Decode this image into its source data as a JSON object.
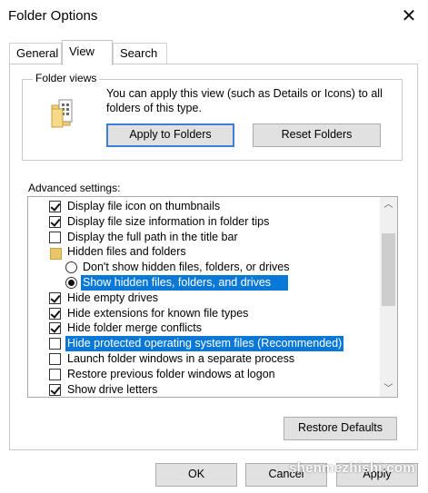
{
  "window": {
    "title": "Folder Options",
    "close_glyph": "✕"
  },
  "tabs": [
    {
      "label": "General"
    },
    {
      "label": "View"
    },
    {
      "label": "Search"
    }
  ],
  "folder_views": {
    "label": "Folder views",
    "icon": "folder-icon",
    "description": "You can apply this view (such as Details or Icons) to all folders of this type.",
    "apply_button": "Apply to Folders",
    "reset_button": "Reset Folders"
  },
  "advanced": {
    "label": "Advanced settings:",
    "items": [
      {
        "type": "checkbox",
        "checked": true,
        "label": "Display file icon on thumbnails"
      },
      {
        "type": "checkbox",
        "checked": true,
        "label": "Display file size information in folder tips"
      },
      {
        "type": "checkbox",
        "checked": false,
        "label": "Display the full path in the title bar"
      },
      {
        "type": "folder",
        "label": "Hidden files and folders"
      },
      {
        "type": "radio",
        "checked": false,
        "label": "Don't show hidden files, folders, or drives"
      },
      {
        "type": "radio",
        "checked": true,
        "label": "Show hidden files, folders, and drives",
        "highlighted": true
      },
      {
        "type": "checkbox",
        "checked": true,
        "label": "Hide empty drives"
      },
      {
        "type": "checkbox",
        "checked": true,
        "label": "Hide extensions for known file types"
      },
      {
        "type": "checkbox",
        "checked": true,
        "label": "Hide folder merge conflicts"
      },
      {
        "type": "checkbox",
        "checked": false,
        "label": "Hide protected operating system files (Recommended)",
        "highlighted": true
      },
      {
        "type": "checkbox",
        "checked": false,
        "label": "Launch folder windows in a separate process"
      },
      {
        "type": "checkbox",
        "checked": false,
        "label": "Restore previous folder windows at logon"
      },
      {
        "type": "checkbox",
        "checked": true,
        "label": "Show drive letters"
      }
    ],
    "restore_button": "Restore Defaults"
  },
  "footer": {
    "ok": "OK",
    "cancel": "Cancel",
    "apply": "Apply"
  },
  "watermark": "shenmezhishi.com",
  "colors": {
    "highlight": "#0a78d7",
    "focus_border": "#3c7fd6",
    "button_bg": "#e1e1e1"
  }
}
